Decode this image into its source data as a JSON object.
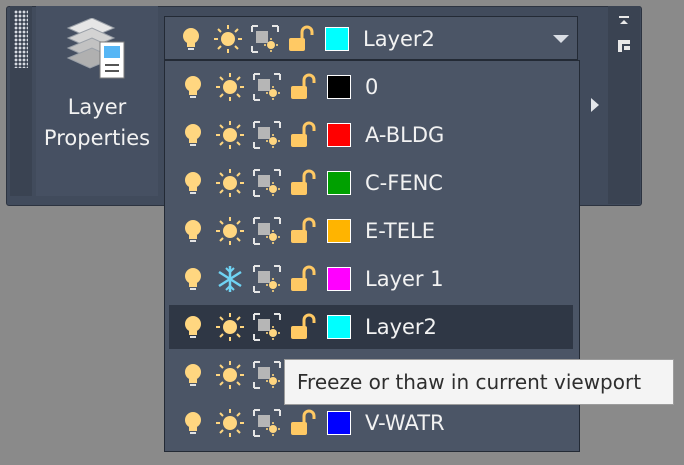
{
  "panel": {
    "button_label_line1": "Layer",
    "button_label_line2": "Properties"
  },
  "combo": {
    "selected_name": "Layer2",
    "selected_color": "#00ffff"
  },
  "layers": [
    {
      "name": "0",
      "color": "#000000",
      "frozen": false,
      "selected": false
    },
    {
      "name": "A-BLDG",
      "color": "#ff0000",
      "frozen": false,
      "selected": false
    },
    {
      "name": "C-FENC",
      "color": "#00a000",
      "frozen": false,
      "selected": false
    },
    {
      "name": "E-TELE",
      "color": "#ffb400",
      "frozen": false,
      "selected": false
    },
    {
      "name": "Layer 1",
      "color": "#ff00ff",
      "frozen": true,
      "selected": false
    },
    {
      "name": "Layer2",
      "color": "#00ffff",
      "frozen": false,
      "selected": true
    },
    {
      "name": "",
      "color": "",
      "frozen": false,
      "selected": false
    },
    {
      "name": "V-WATR",
      "color": "#0000ff",
      "frozen": false,
      "selected": false
    }
  ],
  "tooltip": {
    "text": "Freeze or thaw in current viewport"
  },
  "icons": [
    "lightbulb-icon",
    "sun-icon",
    "viewport-freeze-icon",
    "unlock-icon",
    "snowflake-icon",
    "layers-stack-icon",
    "panel-pin-icon"
  ]
}
